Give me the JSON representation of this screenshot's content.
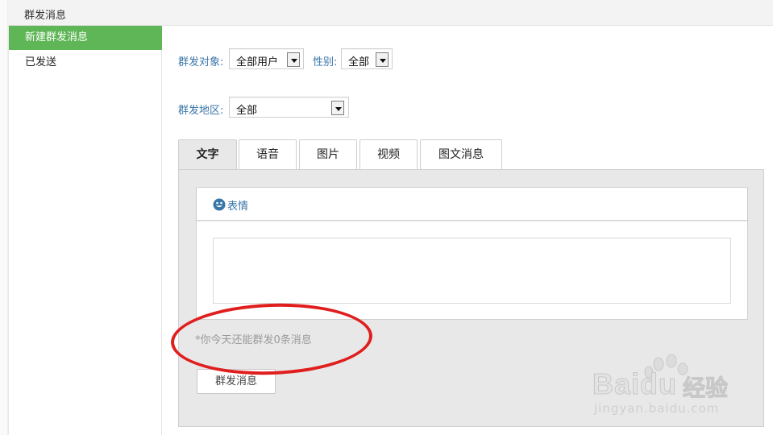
{
  "header": {
    "title": "群发消息"
  },
  "sidebar": {
    "items": [
      {
        "label": "新建群发消息",
        "active": true
      },
      {
        "label": "已发送",
        "active": false
      }
    ]
  },
  "form": {
    "target_label": "群发对象:",
    "target_value": "全部用户",
    "gender_label": "性别:",
    "gender_value": "全部",
    "region_label": "群发地区:",
    "region_value": "全部"
  },
  "tabs": [
    {
      "label": "文字",
      "active": true
    },
    {
      "label": "语音",
      "active": false
    },
    {
      "label": "图片",
      "active": false
    },
    {
      "label": "视频",
      "active": false
    },
    {
      "label": "图文消息",
      "active": false
    }
  ],
  "editor": {
    "emoji_label": "表情",
    "text_value": ""
  },
  "notice": "*你今天还能群发0条消息",
  "send_button": "群发消息",
  "watermark": {
    "brand": "Bai",
    "brand2": "du",
    "brand_cn": "经验",
    "url": "jingyan.baidu.com"
  },
  "colors": {
    "accent_green": "#5fb656",
    "link_blue": "#3a76a8",
    "annotation_red": "#e01e1e"
  }
}
